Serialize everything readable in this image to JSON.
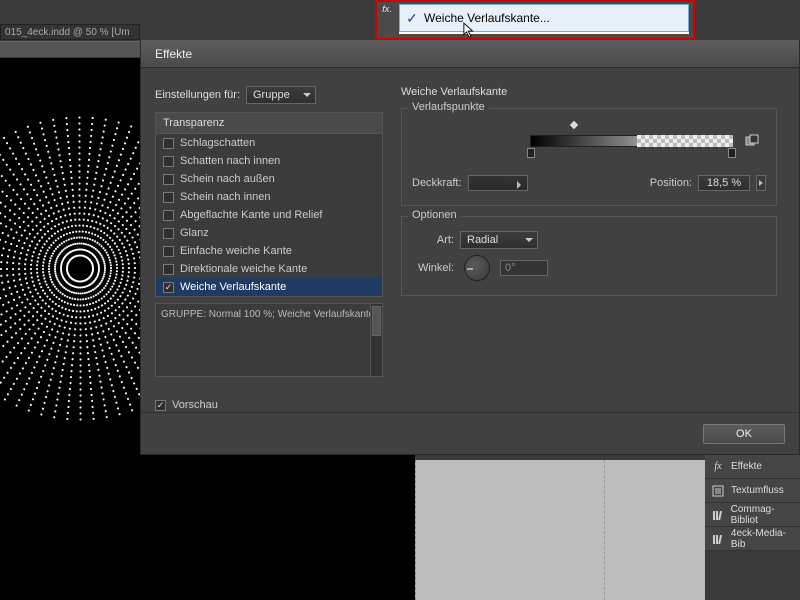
{
  "document": {
    "tab_label": "015_4eck.indd @ 50 % [Um"
  },
  "fx_dropdown": {
    "item_label": "Weiche Verlaufskante...",
    "checked": true
  },
  "dialog": {
    "title": "Effekte",
    "settings_for_label": "Einstellungen für:",
    "settings_for_value": "Gruppe",
    "effects_header": "Transparenz",
    "effects": [
      {
        "label": "Schlagschatten",
        "checked": false
      },
      {
        "label": "Schatten nach innen",
        "checked": false
      },
      {
        "label": "Schein nach außen",
        "checked": false
      },
      {
        "label": "Schein nach innen",
        "checked": false
      },
      {
        "label": "Abgeflachte Kante und Relief",
        "checked": false
      },
      {
        "label": "Glanz",
        "checked": false
      },
      {
        "label": "Einfache weiche Kante",
        "checked": false
      },
      {
        "label": "Direktionale weiche Kante",
        "checked": false
      },
      {
        "label": "Weiche Verlaufskante",
        "checked": true
      }
    ],
    "summary": "GRUPPE: Normal 100 %; Weiche Verlaufskante",
    "preview_label": "Vorschau",
    "preview_checked": true,
    "ok_label": "OK"
  },
  "right_panel": {
    "title": "Weiche Verlaufskante",
    "group_stops": "Verlaufspunkte",
    "opacity_label": "Deckkraft:",
    "position_label": "Position:",
    "position_value": "18,5 %",
    "group_options": "Optionen",
    "type_label": "Art:",
    "type_value": "Radial",
    "angle_label": "Winkel:",
    "angle_value": "0°"
  },
  "side_panels": [
    {
      "icon": "fx",
      "label": "Effekte"
    },
    {
      "icon": "textwrap",
      "label": "Textumfluss"
    },
    {
      "icon": "library",
      "label": "Commag-Bibliot"
    },
    {
      "icon": "library",
      "label": "4eck-Media-Bib"
    }
  ]
}
